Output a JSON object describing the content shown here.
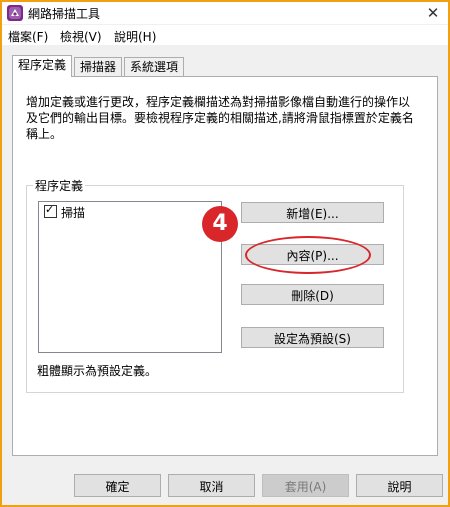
{
  "window": {
    "title": "網路掃描工具",
    "close_glyph": "✕",
    "icon": "app-icon",
    "accent_border_color": "#f0a010"
  },
  "menu": {
    "items": [
      {
        "label": "檔案(F)"
      },
      {
        "label": "檢視(V)"
      },
      {
        "label": "說明(H)"
      }
    ]
  },
  "tabs": [
    {
      "label": "程序定義",
      "active": true
    },
    {
      "label": "掃描器",
      "active": false
    },
    {
      "label": "系統選項",
      "active": false
    }
  ],
  "panel": {
    "description": "增加定義或進行更改，程序定義欄描述為對掃描影像檔自動進行的操作以及它們的輸出目標。要檢視程序定義的相關描述,請將滑鼠指標置於定義名稱上。",
    "group_title": "程序定義",
    "list_items": [
      {
        "label": "掃描",
        "checked": true
      }
    ],
    "buttons": {
      "new": "新增(E)...",
      "properties": "內容(P)...",
      "delete": "刪除(D)",
      "set_default": "設定為預設(S)"
    },
    "note": "粗體顯示為預設定義。"
  },
  "annotation": {
    "badge": "4",
    "color": "#d8262b"
  },
  "footer": {
    "ok": "確定",
    "cancel": "取消",
    "apply": "套用(A)",
    "help": "說明"
  }
}
